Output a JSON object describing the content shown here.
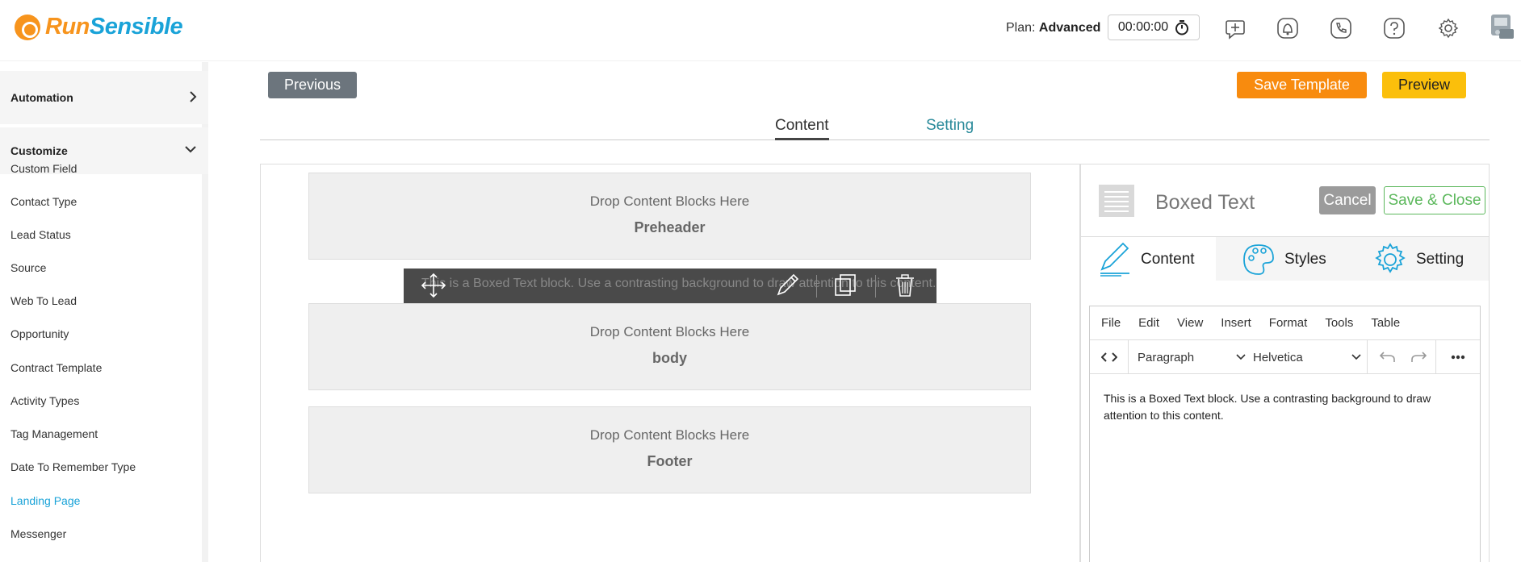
{
  "header": {
    "logo_run": "Run",
    "logo_sensible": "Sensible",
    "plan_label": "Plan:",
    "plan_value": "Advanced",
    "timer": "00:00:00"
  },
  "sidebar": {
    "automation": "Automation",
    "customize": "Customize",
    "items": [
      "Custom Field",
      "Contact Type",
      "Lead Status",
      "Source",
      "Web To Lead",
      "Opportunity",
      "Contract Template",
      "Activity Types",
      "Tag Management",
      "Date To Remember Type",
      "Landing Page",
      "Messenger"
    ],
    "active_item": "Landing Page"
  },
  "actions": {
    "previous": "Previous",
    "save_template": "Save Template",
    "preview": "Preview"
  },
  "tabs": {
    "content": "Content",
    "setting": "Setting"
  },
  "canvas": {
    "drop_label": "Drop Content Blocks Here",
    "zones": [
      "Preheader",
      "body",
      "Footer"
    ],
    "overlay_text": "This is a Boxed Text block. Use a contrasting background to draw attention to this content."
  },
  "panel": {
    "title": "Boxed Text",
    "cancel": "Cancel",
    "save_close": "Save & Close",
    "tabs": [
      "Content",
      "Styles",
      "Setting"
    ],
    "menu": [
      "File",
      "Edit",
      "View",
      "Insert",
      "Format",
      "Tools",
      "Table"
    ],
    "block_format": "Paragraph",
    "font_family": "Helvetica",
    "body_text": "This is a Boxed Text block. Use a contrasting background to draw attention to this content."
  },
  "colors": {
    "brand_orange": "#f7941d",
    "brand_blue": "#1aa3d8",
    "save_template": "#f88b0e",
    "preview": "#fbbf0b",
    "save_close": "#5cb85c"
  }
}
